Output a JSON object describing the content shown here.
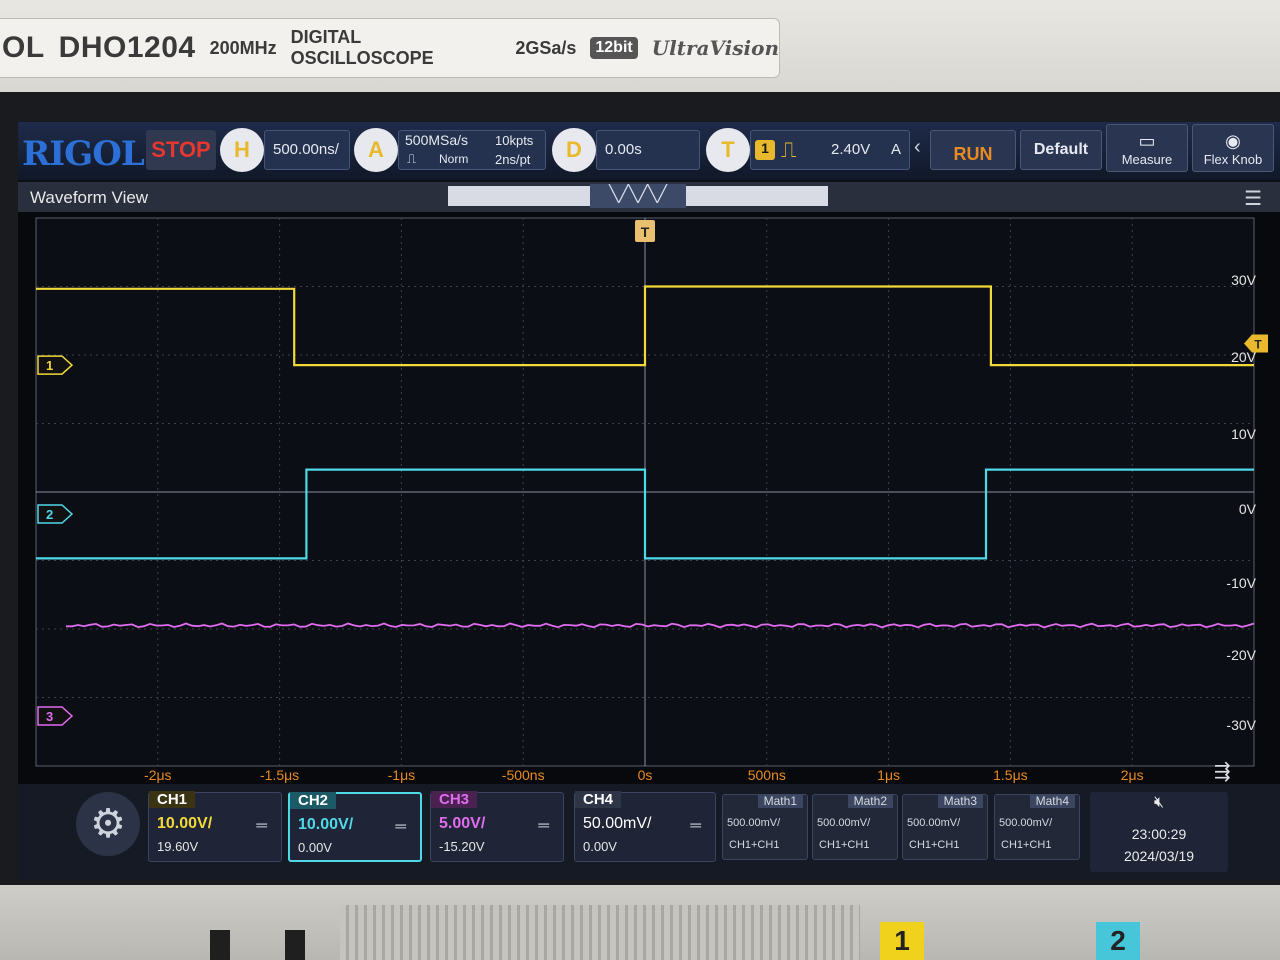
{
  "device": {
    "model": "DHO1204",
    "model_prefix": "OL",
    "bandwidth": "200MHz",
    "type": "DIGITAL OSCILLOSCOPE",
    "sample_rate": "2GSa/s",
    "bits": "12bit",
    "tech": "UltraVision",
    "front_keys": [
      "1",
      "2"
    ]
  },
  "toolbar": {
    "logo": "RIGOL",
    "run_state": "STOP",
    "horizontal_label": "H",
    "timebase": "500.00ns/",
    "acquire_label": "A",
    "sample_rate": "500MSa/s",
    "acq_mode": "Norm",
    "memory_depth": "10kpts",
    "time_per_pt": "2ns/pt",
    "delay_label": "D",
    "delay": "0.00s",
    "trigger_label": "T",
    "trigger_source": "1",
    "trigger_level": "2.40V",
    "trigger_mode": "A",
    "run_button": "RUN",
    "default_button": "Default",
    "measure_button": "Measure",
    "flex_knob_button": "Flex Knob"
  },
  "waveform_view": {
    "title": "Waveform View",
    "trigger_marker": "T",
    "ch1_marker": "1",
    "ch2_marker": "2",
    "ch3_marker": "3",
    "trigger_level_marker": "T"
  },
  "right_axis_labels": [
    "30V",
    "20V",
    "10V",
    "0V",
    "-10V",
    "-20V",
    "-30V"
  ],
  "time_axis_labels": [
    "-2μs",
    "-1.5μs",
    "-1μs",
    "-500ns",
    "0s",
    "500ns",
    "1μs",
    "1.5μs",
    "2μs"
  ],
  "channels": [
    {
      "name": "CH1",
      "scale": "10.00V/",
      "offset": "19.60V",
      "color": "#f2d93a"
    },
    {
      "name": "CH2",
      "scale": "10.00V/",
      "offset": "0.00V",
      "color": "#4fd8e8"
    },
    {
      "name": "CH3",
      "scale": "5.00V/",
      "offset": "-15.20V",
      "color": "#e06cf0"
    },
    {
      "name": "CH4",
      "scale": "50.00mV/",
      "offset": "0.00V",
      "color": "#ffffff"
    }
  ],
  "math": [
    {
      "name": "Math1",
      "scale": "500.00mV/",
      "source": "CH1+CH1"
    },
    {
      "name": "Math2",
      "scale": "500.00mV/",
      "source": "CH1+CH1"
    },
    {
      "name": "Math3",
      "scale": "500.00mV/",
      "source": "CH1+CH1"
    },
    {
      "name": "Math4",
      "scale": "500.00mV/",
      "source": "CH1+CH1"
    }
  ],
  "status": {
    "speaker_icon": "speaker-muted-icon",
    "time": "23:00:29",
    "date": "2024/03/19"
  },
  "chart_data": {
    "type": "line",
    "x_unit": "μs",
    "xlim": [
      -2.5,
      2.5
    ],
    "series": [
      {
        "name": "CH1",
        "x": [
          -2.5,
          -1.44,
          -1.44,
          0.0,
          0.0,
          1.42,
          1.42,
          2.5
        ],
        "y": [
          29.5,
          29.5,
          19.6,
          19.6,
          29.8,
          29.8,
          19.6,
          19.6
        ]
      },
      {
        "name": "CH2",
        "x": [
          -2.5,
          -1.39,
          -1.39,
          0.0,
          0.0,
          1.4,
          1.4,
          2.5
        ],
        "y": [
          -6.0,
          -6.0,
          6.0,
          6.0,
          -6.0,
          -6.0,
          6.0,
          6.0
        ]
      },
      {
        "name": "CH3",
        "x": [
          -2.5,
          2.5
        ],
        "y": [
          -15.2,
          -15.2
        ]
      }
    ]
  }
}
